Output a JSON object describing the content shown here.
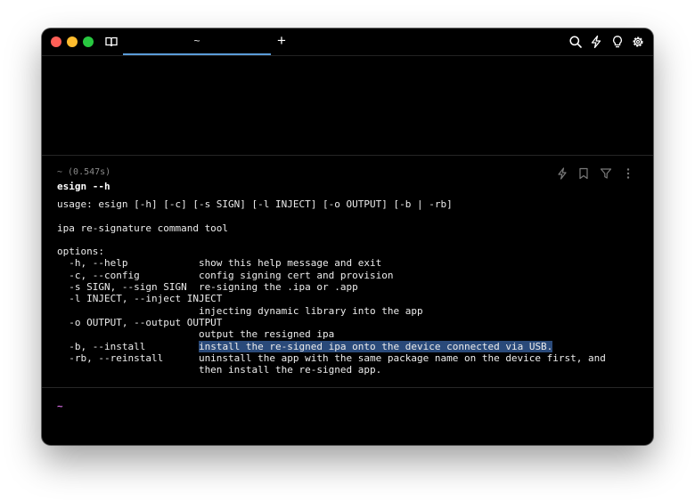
{
  "tab": {
    "title": "~"
  },
  "newtab_label": "+",
  "block": {
    "meta": "~ (0.547s)",
    "command": "esign --h",
    "lines": [
      "usage: esign [-h] [-c] [-s SIGN] [-l INJECT] [-o OUTPUT] [-b | -rb]",
      "",
      "ipa re-signature command tool",
      "",
      "options:",
      "  -h, --help            show this help message and exit",
      "  -c, --config          config signing cert and provision",
      "  -s SIGN, --sign SIGN  re-signing the .ipa or .app",
      "  -l INJECT, --inject INJECT",
      "                        injecting dynamic library into the app",
      "  -o OUTPUT, --output OUTPUT",
      "                        output the resigned ipa",
      "  -b, --install         ",
      "  -rb, --reinstall      uninstall the app with the same package name on the device first, and",
      "                        then install the re-signed app."
    ],
    "highlighted_text": "install the re-signed ipa onto the device connected via USB."
  },
  "prompt": "~",
  "colors": {
    "background": "#000000",
    "tab_accent": "#5a9bd8",
    "selection": "#2a4a7a",
    "prompt": "#d36be0"
  },
  "icons": {
    "titlebar_left": "book-icon",
    "titlebar_right": [
      "search-icon",
      "bolt-icon",
      "lightbulb-icon",
      "gear-icon"
    ],
    "block_actions": [
      "bolt-icon",
      "bookmark-icon",
      "filter-icon",
      "more-vertical-icon"
    ]
  }
}
